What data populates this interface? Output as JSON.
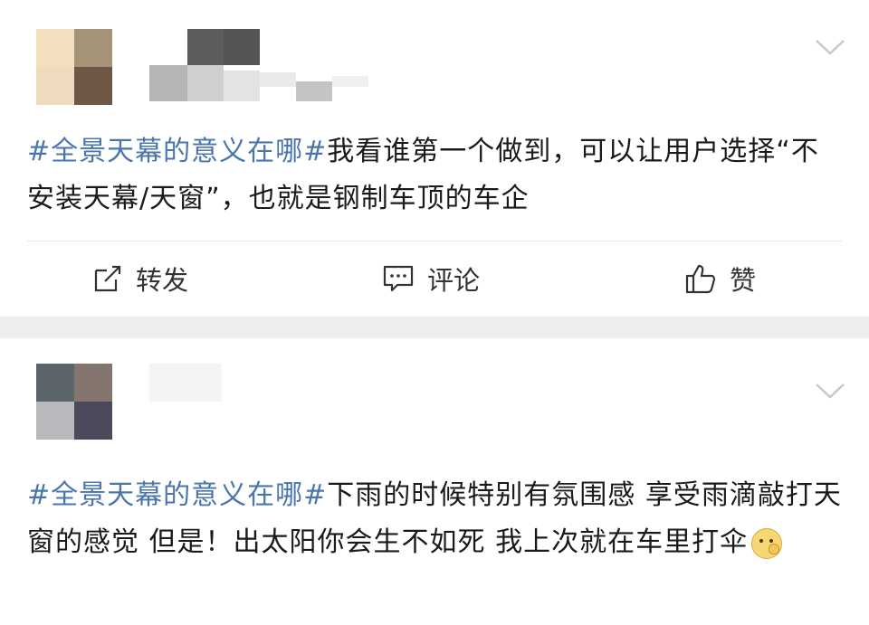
{
  "posts": [
    {
      "segments": [
        {
          "type": "tag",
          "text": "#全景天幕的意义在哪#"
        },
        {
          "type": "text",
          "text": "我看谁第一个做到，可以让用户选择“不安装天幕/天窗”，也就是钢制车顶的车企"
        }
      ],
      "actions": {
        "repost_label": "转发",
        "comment_label": "评论",
        "like_label": "赞"
      }
    },
    {
      "segments": [
        {
          "type": "tag",
          "text": "#全景天幕的意义在哪#"
        },
        {
          "type": "text",
          "text": "下雨的时候特别有氛围感 享受雨滴敲打天窗的感觉 但是！出太阳你会生不如死 我上次就在车里打伞"
        }
      ],
      "emoji": "smirk-emoji"
    }
  ],
  "colors": {
    "tag": "#4a76ab",
    "text": "#1a1a1a",
    "separator": "#eeeeee"
  },
  "icons": [
    "chevron-down-icon",
    "repost-icon",
    "comment-icon",
    "thumbs-up-icon"
  ]
}
